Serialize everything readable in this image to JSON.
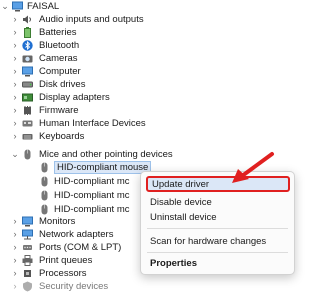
{
  "tree": {
    "root": {
      "label": "FAISAL",
      "icon": "computer-icon"
    },
    "items": [
      {
        "label": "Audio inputs and outputs",
        "icon": "speaker-icon"
      },
      {
        "label": "Batteries",
        "icon": "battery-icon"
      },
      {
        "label": "Bluetooth",
        "icon": "bluetooth-icon"
      },
      {
        "label": "Cameras",
        "icon": "camera-icon"
      },
      {
        "label": "Computer",
        "icon": "monitor-icon"
      },
      {
        "label": "Disk drives",
        "icon": "disk-icon"
      },
      {
        "label": "Display adapters",
        "icon": "display-adapter-icon"
      },
      {
        "label": "Firmware",
        "icon": "chip-icon"
      },
      {
        "label": "Human Interface Devices",
        "icon": "hid-icon"
      },
      {
        "label": "Keyboards",
        "icon": "keyboard-icon"
      },
      {
        "label": "Mice and other pointing devices",
        "icon": "mouse-icon",
        "expanded": true
      },
      {
        "label": "HID-compliant mouse",
        "icon": "mouse-icon",
        "child": true,
        "selected": true
      },
      {
        "label": "HID-compliant mc",
        "icon": "mouse-icon",
        "child": true
      },
      {
        "label": "HID-compliant mc",
        "icon": "mouse-icon",
        "child": true
      },
      {
        "label": "HID-compliant mc",
        "icon": "mouse-icon",
        "child": true
      },
      {
        "label": "Monitors",
        "icon": "monitor-icon"
      },
      {
        "label": "Network adapters",
        "icon": "network-icon"
      },
      {
        "label": "Ports (COM & LPT)",
        "icon": "port-icon"
      },
      {
        "label": "Print queues",
        "icon": "printer-icon"
      },
      {
        "label": "Processors",
        "icon": "cpu-icon"
      },
      {
        "label": "Security devices",
        "icon": "security-icon"
      }
    ]
  },
  "context_menu": {
    "items": [
      {
        "label": "Update driver",
        "highlighted": true
      },
      {
        "label": "Disable device"
      },
      {
        "label": "Uninstall device"
      },
      {
        "label": "Scan for hardware changes"
      },
      {
        "label": "Properties",
        "bold": true
      }
    ]
  },
  "colors": {
    "accent": "#1f6fd1",
    "highlight_border": "#e02020",
    "arrow": "#e02020",
    "selection_bg": "#dbe7f7"
  }
}
